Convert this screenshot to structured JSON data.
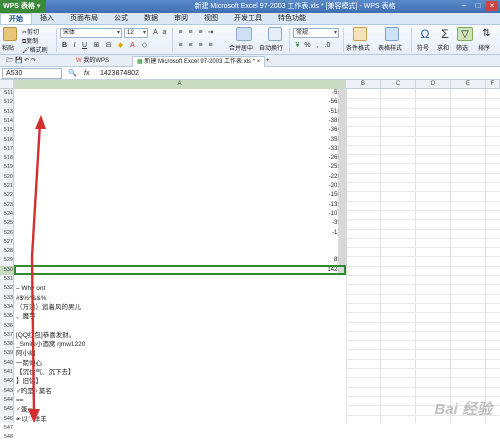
{
  "titlebar": {
    "app_menu": "WPS 表格",
    "title": "新建 Microsoft Excel 97-2003 工作表.xls * [兼容模式] - WPS 表格"
  },
  "ribbon_tabs": [
    "开始",
    "插入",
    "页面布局",
    "公式",
    "数据",
    "审阅",
    "视图",
    "开发工具",
    "特色功能"
  ],
  "ribbon": {
    "paste": "粘贴",
    "cut": "剪切",
    "copy": "复制",
    "format_painter": "格式刷",
    "font_name": "宋体",
    "font_size": "12",
    "merge_center": "合并居中",
    "wrap_text": "自动换行",
    "number_format": "常规",
    "conditional_format": "条件格式",
    "table_style": "表格样式",
    "symbol": "符号",
    "sum": "求和",
    "filter": "筛选",
    "sort": "排序"
  },
  "doc_tabs": {
    "tab1": "我的WPS",
    "tab2": "新建 Microsoft Excel 97-2003 工作表.xls *",
    "new_tab": "+"
  },
  "formula_bar": {
    "name_box": "A530",
    "fx": "fx",
    "value": "1423874802"
  },
  "columns": [
    "A",
    "B",
    "C",
    "D",
    "E",
    "F"
  ],
  "rows": [
    {
      "n": "511",
      "a": "-587",
      "t": ""
    },
    {
      "n": "512",
      "a": "-5610",
      "t": ""
    },
    {
      "n": "513",
      "a": "-5185",
      "t": ""
    },
    {
      "n": "514",
      "a": "-3862",
      "t": ""
    },
    {
      "n": "515",
      "a": "-3641",
      "t": ""
    },
    {
      "n": "516",
      "a": "-3598",
      "t": ""
    },
    {
      "n": "517",
      "a": "-3380",
      "t": ""
    },
    {
      "n": "518",
      "a": "-2656",
      "t": ""
    },
    {
      "n": "519",
      "a": "-2580",
      "t": ""
    },
    {
      "n": "520",
      "a": "-2280",
      "t": ""
    },
    {
      "n": "521",
      "a": "-2030",
      "t": ""
    },
    {
      "n": "522",
      "a": "-1598",
      "t": ""
    },
    {
      "n": "523",
      "a": "-1392",
      "t": ""
    },
    {
      "n": "524",
      "a": "-1071",
      "t": ""
    },
    {
      "n": "525",
      "a": "-397",
      "t": ""
    },
    {
      "n": "526",
      "a": "-174",
      "t": ""
    },
    {
      "n": "527",
      "a": "",
      "t": ""
    },
    {
      "n": "528",
      "a": "5",
      "t": ""
    },
    {
      "n": "529",
      "a": "897",
      "t": ""
    },
    {
      "n": "530",
      "a": "14238",
      "t": ""
    },
    {
      "n": "531",
      "a": "",
      "t": ""
    },
    {
      "n": "532",
      "a": "",
      "t": "– Why ont"
    },
    {
      "n": "533",
      "a": "",
      "t": "#$%^&&%"
    },
    {
      "n": "534",
      "a": "",
      "t": "（万洪）追着风的男儿"
    },
    {
      "n": "535",
      "a": "",
      "t": "、魔芋"
    },
    {
      "n": "536",
      "a": "",
      "t": ""
    },
    {
      "n": "537",
      "a": "",
      "t": "[QQ红包]恭喜发财。"
    },
    {
      "n": "538",
      "a": "",
      "t": "_Smile小酒窝 rjmw1220"
    },
    {
      "n": "539",
      "a": "",
      "t": "阿小编"
    },
    {
      "n": "540",
      "a": "",
      "t": "一箭倾心"
    },
    {
      "n": "541",
      "a": "",
      "t": "【沉住气、沉下去】"
    },
    {
      "n": "542",
      "a": "",
      "t": "】旧忆】"
    },
    {
      "n": "543",
      "a": "",
      "t": "♂旳是♀莫名"
    },
    {
      "n": "544",
      "a": "",
      "t": "=="
    },
    {
      "n": "545",
      "a": "",
      "t": "♂蛋ஐ"
    },
    {
      "n": "546",
      "a": "",
      "t": "↞以♡洋羊"
    },
    {
      "n": "547",
      "a": "",
      "t": "⁄ °花美兮╰已认证"
    },
    {
      "n": "548",
      "a": "",
      "t": "♂ ♫"
    }
  ],
  "watermark": "Bai 经验"
}
